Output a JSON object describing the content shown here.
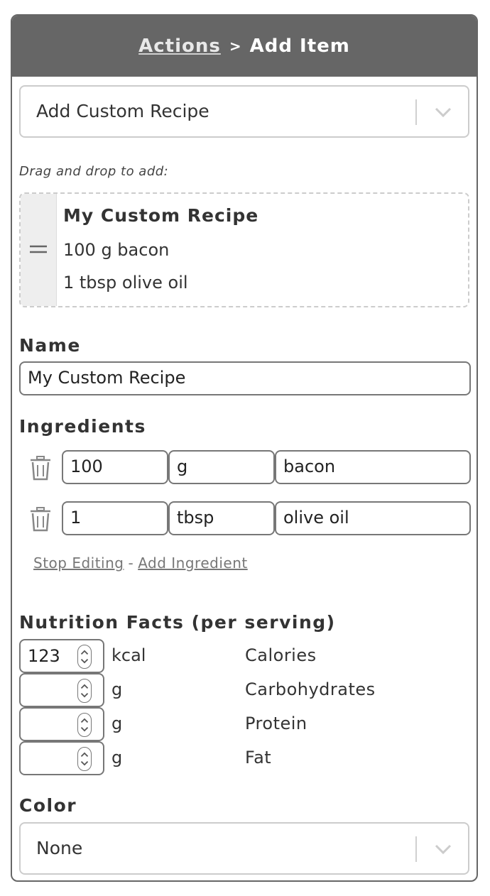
{
  "header": {
    "breadcrumb_link": "Actions",
    "separator": ">",
    "title": "Add Item"
  },
  "item_type_select": {
    "selected": "Add Custom Recipe"
  },
  "drag_hint": "Drag and drop to add:",
  "draggable_recipe": {
    "title": "My Custom Recipe",
    "lines": [
      "100 g bacon",
      "1 tbsp olive oil"
    ]
  },
  "name_section": {
    "label": "Name",
    "value": "My Custom Recipe"
  },
  "ingredients_section": {
    "label": "Ingredients",
    "rows": [
      {
        "amount": "100",
        "unit": "g",
        "ingredient": "bacon"
      },
      {
        "amount": "1",
        "unit": "tbsp",
        "ingredient": "olive oil"
      }
    ],
    "stop_editing_label": "Stop Editing",
    "separator": "-",
    "add_ingredient_label": "Add Ingredient"
  },
  "nutrition_section": {
    "label": "Nutrition Facts (per serving)",
    "rows": [
      {
        "value": "123",
        "unit": "kcal",
        "name": "Calories"
      },
      {
        "value": "",
        "unit": "g",
        "name": "Carbohydrates"
      },
      {
        "value": "",
        "unit": "g",
        "name": "Protein"
      },
      {
        "value": "",
        "unit": "g",
        "name": "Fat"
      }
    ]
  },
  "color_section": {
    "label": "Color",
    "selected": "None"
  },
  "colors": {
    "header_bg": "#666666",
    "border": "#777777",
    "muted_text": "#777777"
  }
}
